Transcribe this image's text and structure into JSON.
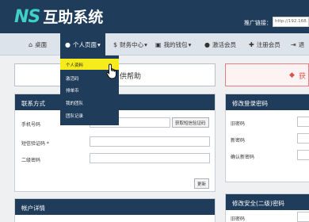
{
  "header": {
    "logo_mark": "NS",
    "logo_text": "互助系统",
    "promo_label": "推广链接：",
    "promo_value": "http://192.168.1"
  },
  "nav": {
    "items": [
      {
        "icon": "home-icon",
        "glyph": "⌂",
        "label": "桌面"
      },
      {
        "icon": "user-icon",
        "glyph": "●",
        "label": "个人页面",
        "caret": "▾"
      },
      {
        "icon": "dollar-icon",
        "glyph": "$",
        "label": "财务中心",
        "caret": "▾"
      },
      {
        "icon": "wallet-icon",
        "glyph": "▣",
        "label": "我的钱包",
        "caret": "▾"
      },
      {
        "icon": "info-icon",
        "glyph": "●",
        "label": "激活会员"
      },
      {
        "icon": "add-user-icon",
        "glyph": "✚",
        "label": "注册会员"
      },
      {
        "icon": "sign-out-icon",
        "glyph": "⇥",
        "label": "退"
      }
    ]
  },
  "dropdown": {
    "items": [
      "个人资料",
      "激活码",
      "排单币",
      "我的团队",
      "团队记录"
    ],
    "highlighted": 0
  },
  "banner": {
    "left_text": "供帮助",
    "right_text": "获"
  },
  "contact": {
    "title": "联系方式",
    "phone_label": "手机号码",
    "sms_button": "获取短信验证码",
    "sms_label": "短信验证码 *",
    "pin_label": "二级密码",
    "submit": "更新"
  },
  "account": {
    "title": "帐户详情"
  },
  "login_pwd": {
    "title": "修改登录密码",
    "old_label": "旧密码",
    "new_label": "新密码",
    "confirm_label": "确认新密码"
  },
  "security_pwd": {
    "title": "修改安全(二级)密码",
    "old_label": "旧密码"
  },
  "colors": {
    "navy": "#1f3c5a",
    "accent": "#3fd0c9",
    "highlight": "#f6ec1b"
  }
}
